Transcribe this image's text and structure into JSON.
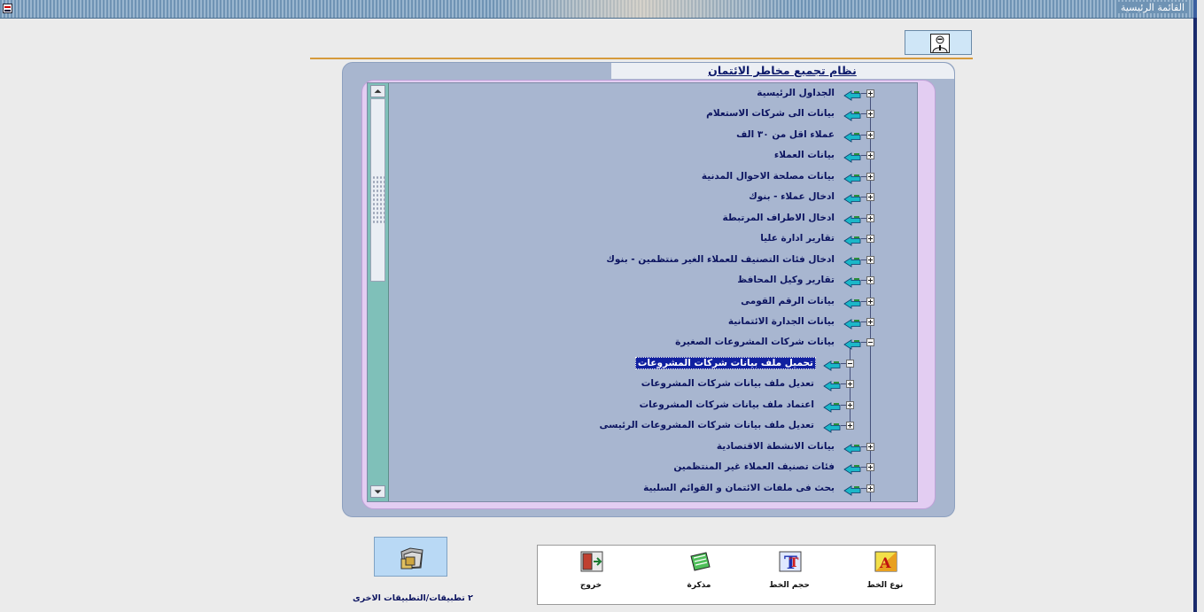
{
  "window": {
    "title": "القائمة الرئيسية"
  },
  "header": {
    "help_icon": "help-person-icon"
  },
  "panel": {
    "title": "نظام تجميع مخاطر الائتمان"
  },
  "tree": {
    "items": [
      {
        "label": "الجداول الرئيسية",
        "state": "collapsed",
        "level": 0
      },
      {
        "label": "بيانات الى شركات الاستعلام",
        "state": "collapsed",
        "level": 0
      },
      {
        "label": "عملاء اقل من ٣٠ الف",
        "state": "collapsed",
        "level": 0
      },
      {
        "label": "بيانات العملاء",
        "state": "collapsed",
        "level": 0
      },
      {
        "label": "بيانات مصلحة الاحوال المدنية",
        "state": "collapsed",
        "level": 0
      },
      {
        "label": "ادخال عملاء - بنوك",
        "state": "collapsed",
        "level": 0
      },
      {
        "label": "ادخال الاطراف المرتبطة",
        "state": "collapsed",
        "level": 0
      },
      {
        "label": "تقارير ادارة عليا",
        "state": "collapsed",
        "level": 0
      },
      {
        "label": "ادخال فئات التصنيف للعملاء الغير منتظمين - بنوك",
        "state": "collapsed",
        "level": 0
      },
      {
        "label": "تقارير وكيل المحافظ",
        "state": "collapsed",
        "level": 0
      },
      {
        "label": "بيانات الرقم القومى",
        "state": "collapsed",
        "level": 0
      },
      {
        "label": "بيانات الجدارة الائتمانية",
        "state": "collapsed",
        "level": 0
      },
      {
        "label": "بيانات شركات المشروعات الصغيرة",
        "state": "expanded",
        "level": 0
      },
      {
        "label": "تحميل ملف بيانات شركات المشروعات",
        "state": "expanded",
        "level": 1,
        "selected": true
      },
      {
        "label": "تعديل ملف بيانات شركات المشروعات",
        "state": "collapsed",
        "level": 1
      },
      {
        "label": "اعتماد ملف بيانات شركات المشروعات",
        "state": "collapsed",
        "level": 1
      },
      {
        "label": "تعديل ملف بيانات شركات المشروعات الرئيسى",
        "state": "collapsed",
        "level": 1
      },
      {
        "label": "بيانات الانشطة الاقتصادية",
        "state": "collapsed",
        "level": 0
      },
      {
        "label": "فئات تصنيف العملاء غير المنتظمين",
        "state": "collapsed",
        "level": 0
      },
      {
        "label": "بحث فى ملفات الائتمان و القوائم السلبية",
        "state": "collapsed",
        "level": 0
      }
    ]
  },
  "toolbar": {
    "items": [
      {
        "label": "خروج",
        "icon": "exit-door-icon"
      },
      {
        "label": "مذكرة",
        "icon": "notepad-icon"
      },
      {
        "label": "حجم الخط",
        "icon": "font-size-icon"
      },
      {
        "label": "نوع الخط",
        "icon": "font-type-icon"
      }
    ]
  },
  "apps": {
    "label": "٢ تطبيقات/التطبيقات الاخرى",
    "icon": "folders-icon"
  },
  "colors": {
    "selected_bg": "#1020a0",
    "tree_bg": "#a8b6d0",
    "tree_text": "#0c1460",
    "hand_icon": "#1bb7c8"
  }
}
